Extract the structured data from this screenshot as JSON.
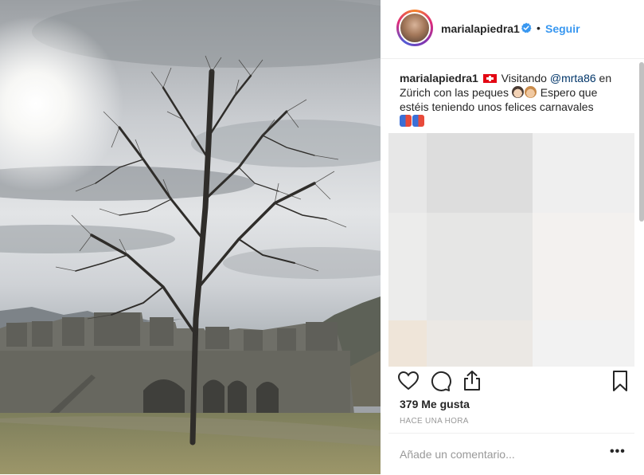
{
  "post": {
    "username": "marialapiedra1",
    "follow_label": "Seguir",
    "separator": "•",
    "caption": {
      "username": "marialapiedra1",
      "text_1": " Visitando ",
      "mention": "@mrta86",
      "text_2": " en Zürich con las peques ",
      "text_3": " Espero que estéis teniendo unos felices carnavales"
    },
    "likes": "379 Me gusta",
    "time": "HACE UNA HORA",
    "comment_placeholder": "Añade un comentario...",
    "more_label": "•••"
  },
  "colors": {
    "accent_blue": "#3897f0",
    "mention_blue": "#003569",
    "text": "#262626",
    "muted": "#999999",
    "border": "#efefef"
  },
  "icons": [
    "verified-badge-icon",
    "swiss-flag-icon",
    "heart-icon",
    "comment-icon",
    "share-icon",
    "bookmark-icon",
    "more-options-icon"
  ]
}
